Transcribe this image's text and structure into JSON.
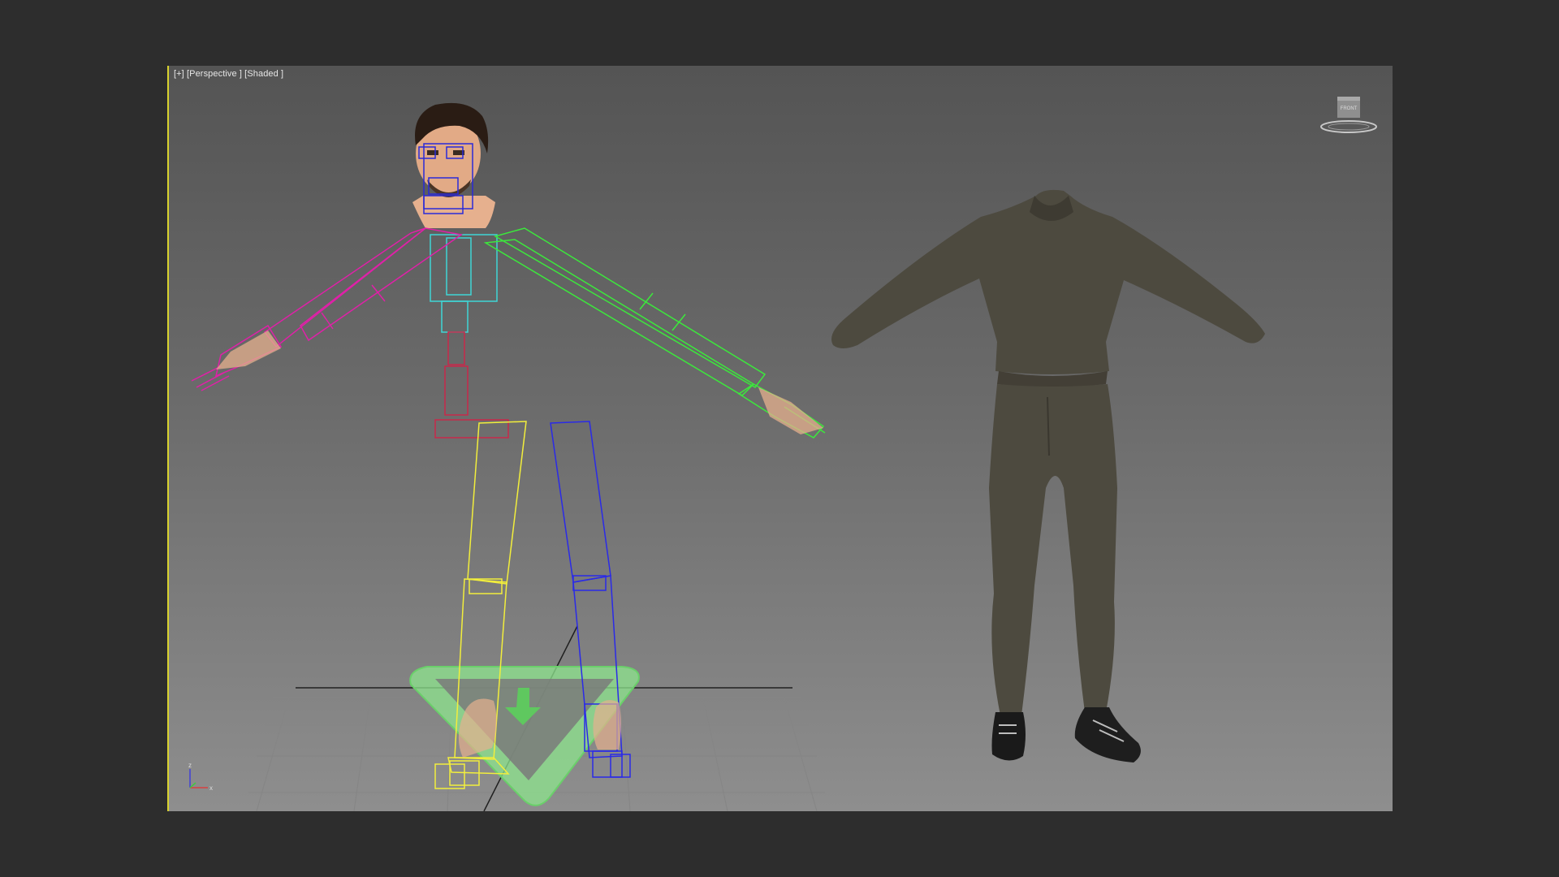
{
  "viewport": {
    "label": "[+] [Perspective ] [Shaded ]",
    "viewcube_label": "FRONT",
    "axis_x": "x",
    "axis_z": "z"
  },
  "scene": {
    "objects": [
      "biped-rig",
      "character-head",
      "hoodie",
      "sweatpants",
      "sneakers",
      "ground-grid",
      "biped-root-controller"
    ],
    "colors": {
      "spine": "#3fd6d6",
      "pelvis": "#c8284a",
      "left_arm": "#e020a8",
      "right_arm": "#3ce83c",
      "left_leg": "#f2ee3c",
      "right_leg": "#2a2ae8",
      "face_rig": "#2a2ad8",
      "root_controller": "#7ee07e",
      "clothing": "#4d4a3f",
      "skin": "#e6b08e",
      "hair": "#2a1c14",
      "active_border": "#d8d22e"
    }
  }
}
